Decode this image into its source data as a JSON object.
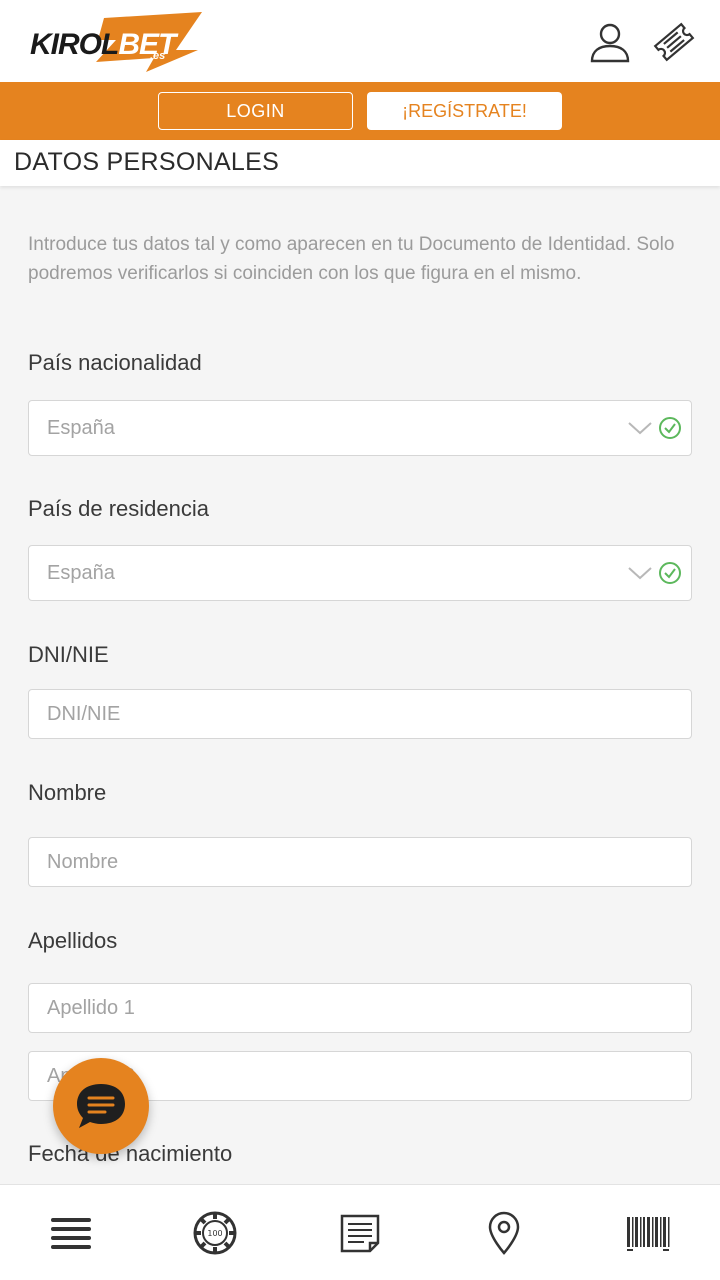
{
  "header": {
    "logo": {
      "main": "KIROL",
      "accent": "BET",
      "suffix": ".es"
    },
    "icons": {
      "user": "user-icon",
      "ticket": "ticket-icon"
    }
  },
  "auth": {
    "login_label": "LOGIN",
    "register_label": "¡REGÍSTRATE!"
  },
  "section": {
    "title": "DATOS PERSONALES"
  },
  "form": {
    "intro": "Introduce tus datos tal y como aparecen en tu Documento de Identidad. Solo podremos verificarlos si coinciden con los que figura en el mismo.",
    "nationality": {
      "label": "País nacionalidad",
      "value": "España"
    },
    "residence": {
      "label": "País de residencia",
      "value": "España"
    },
    "dni": {
      "label": "DNI/NIE",
      "placeholder": "DNI/NIE"
    },
    "name": {
      "label": "Nombre",
      "placeholder": "Nombre"
    },
    "surnames": {
      "label": "Apellidos",
      "placeholder1": "Apellido 1",
      "placeholder2": "Apellido 2"
    },
    "birthdate": {
      "label": "Fecha de nacimiento"
    }
  },
  "bottom_nav": {
    "items": [
      "menu-icon",
      "casino-chip-icon",
      "betslip-icon",
      "location-icon",
      "barcode-icon"
    ]
  },
  "colors": {
    "brand_orange": "#e5831f",
    "valid_green": "#5cb85c",
    "text_dark": "#333333",
    "text_muted": "#9b9b9b"
  }
}
